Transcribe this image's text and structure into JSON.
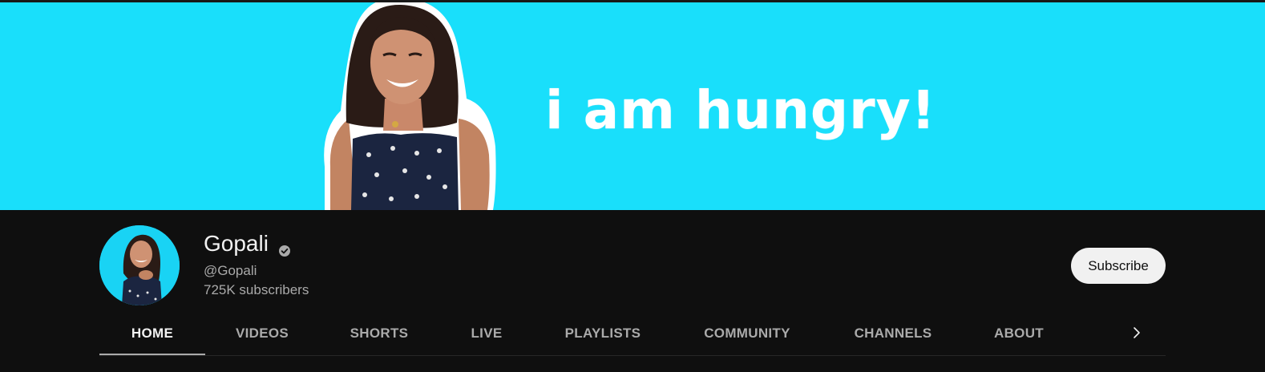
{
  "banner": {
    "text": "i am hungry!",
    "background_color": "#19dffb"
  },
  "channel": {
    "name": "Gopali",
    "handle": "@Gopali",
    "subscribers": "725K subscribers",
    "verified": true
  },
  "actions": {
    "subscribe_label": "Subscribe"
  },
  "tabs": [
    {
      "label": "HOME",
      "active": true
    },
    {
      "label": "VIDEOS",
      "active": false
    },
    {
      "label": "SHORTS",
      "active": false
    },
    {
      "label": "LIVE",
      "active": false
    },
    {
      "label": "PLAYLISTS",
      "active": false
    },
    {
      "label": "COMMUNITY",
      "active": false
    },
    {
      "label": "CHANNELS",
      "active": false
    },
    {
      "label": "ABOUT",
      "active": false
    }
  ],
  "icons": {
    "verified": "verified-check-icon",
    "scroll": "chevron-right-icon"
  },
  "colors": {
    "page_bg": "#0f0f0f",
    "text_primary": "#f1f1f1",
    "text_secondary": "#aaaaaa",
    "button_bg": "#f1f1f1"
  }
}
